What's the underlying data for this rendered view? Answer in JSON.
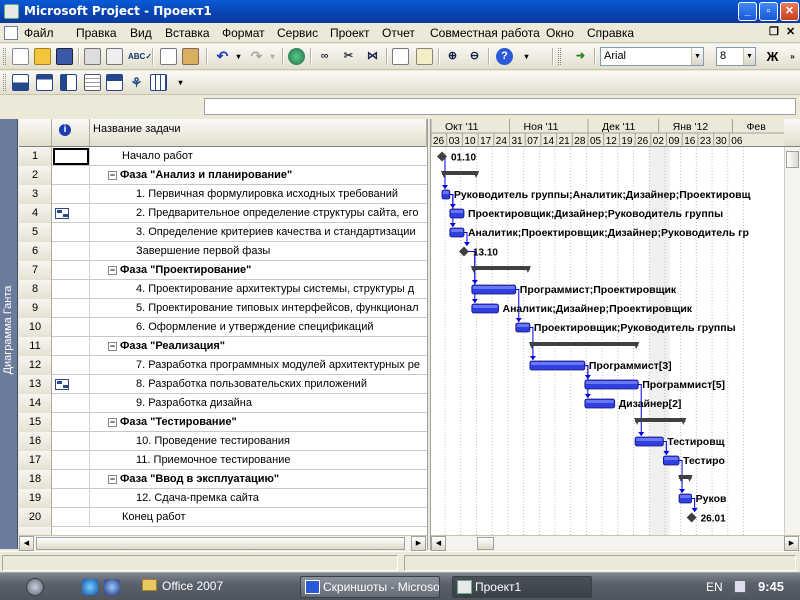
{
  "window": {
    "title": "Microsoft Project - Проект1"
  },
  "menu": [
    "Файл",
    "Правка",
    "Вид",
    "Вставка",
    "Формат",
    "Сервис",
    "Проект",
    "Отчет",
    "Совместная работа",
    "Окно",
    "Справка"
  ],
  "formatting": {
    "font": "Arial",
    "size": "8",
    "bold": "Ж"
  },
  "toolbar_icons": [
    "new-icon",
    "open-icon",
    "save-icon",
    "print-icon",
    "print-preview-icon",
    "spelling-icon",
    "copy-icon",
    "paste-icon",
    "undo-icon",
    "redo-icon",
    "hyperlink-icon",
    "link-tasks-icon",
    "unlink-tasks-icon",
    "split-task-icon",
    "task-info-icon",
    "task-notes-icon",
    "zoom-in-icon",
    "zoom-out-icon",
    "help-icon"
  ],
  "view_icons": [
    "gantt-view-icon",
    "tracking-gantt-icon",
    "task-usage-icon",
    "calendar-view-icon",
    "network-diagram-icon",
    "resource-sheet-icon",
    "resource-usage-icon"
  ],
  "sidebar": {
    "view_name": "Диаграмма Ганта"
  },
  "table": {
    "headers": {
      "info": "i",
      "name": "Название задачи"
    },
    "rows": [
      {
        "id": "1",
        "name": "Начало работ",
        "level": 0,
        "summary": false,
        "note": false
      },
      {
        "id": "2",
        "name": "Фаза \"Анализ и планирование\"",
        "level": 0,
        "summary": true,
        "note": false
      },
      {
        "id": "3",
        "name": "1. Первичная формулировка исходных требований",
        "level": 1,
        "summary": false,
        "note": false
      },
      {
        "id": "4",
        "name": "2. Предварительное определение структуры сайта, его",
        "level": 1,
        "summary": false,
        "note": true
      },
      {
        "id": "5",
        "name": "3. Определение критериев качества и стандартизации",
        "level": 1,
        "summary": false,
        "note": false
      },
      {
        "id": "6",
        "name": "Завершение первой фазы",
        "level": 1,
        "summary": false,
        "note": false
      },
      {
        "id": "7",
        "name": "Фаза \"Проектирование\"",
        "level": 0,
        "summary": true,
        "note": false
      },
      {
        "id": "8",
        "name": "4. Проектирование архитектуры системы, структуры д",
        "level": 1,
        "summary": false,
        "note": false
      },
      {
        "id": "9",
        "name": "5. Проектирование типовых интерфейсов, функционал",
        "level": 1,
        "summary": false,
        "note": false
      },
      {
        "id": "10",
        "name": "6. Оформление и утверждение спецификаций",
        "level": 1,
        "summary": false,
        "note": false
      },
      {
        "id": "11",
        "name": "Фаза \"Реализация\"",
        "level": 0,
        "summary": true,
        "note": false
      },
      {
        "id": "12",
        "name": "7. Разработка программных модулей архитектурных ре",
        "level": 1,
        "summary": false,
        "note": false
      },
      {
        "id": "13",
        "name": "8. Разработка пользовательских приложений",
        "level": 1,
        "summary": false,
        "note": true
      },
      {
        "id": "14",
        "name": "9. Разработка дизайна",
        "level": 1,
        "summary": false,
        "note": false
      },
      {
        "id": "15",
        "name": "Фаза \"Тестирование\"",
        "level": 0,
        "summary": true,
        "note": false
      },
      {
        "id": "16",
        "name": "10. Проведение тестирования",
        "level": 1,
        "summary": false,
        "note": false
      },
      {
        "id": "17",
        "name": "11. Приемочное тестирование",
        "level": 1,
        "summary": false,
        "note": false
      },
      {
        "id": "18",
        "name": "Фаза \"Ввод в эксплуатацию\"",
        "level": 0,
        "summary": true,
        "note": false
      },
      {
        "id": "19",
        "name": "12. Сдача-премка сайта",
        "level": 1,
        "summary": false,
        "note": false
      },
      {
        "id": "20",
        "name": "Конец работ",
        "level": 0,
        "summary": false,
        "note": false
      }
    ]
  },
  "gantt": {
    "months": [
      {
        "label": "Окт '11"
      },
      {
        "label": "Ноя '11"
      },
      {
        "label": "Дек '11"
      },
      {
        "label": "Янв '12"
      },
      {
        "label": "Фев"
      }
    ],
    "days": [
      "26",
      "03",
      "10",
      "17",
      "24",
      "31",
      "07",
      "14",
      "21",
      "28",
      "05",
      "12",
      "19",
      "26",
      "02",
      "09",
      "16",
      "23",
      "30",
      "06"
    ],
    "tasks": [
      {
        "row": 1,
        "type": "milestone",
        "start": 0.7,
        "label": "01.10"
      },
      {
        "row": 2,
        "type": "summary",
        "start": 0.7,
        "end": 3.0
      },
      {
        "row": 3,
        "type": "task",
        "start": 0.7,
        "end": 1.2,
        "label": "Руководитель группы;Аналитик;Дизайнер;Проектировщ"
      },
      {
        "row": 4,
        "type": "task",
        "start": 1.2,
        "end": 2.1,
        "label": "Проектировщик;Дизайнер;Руководитель группы"
      },
      {
        "row": 5,
        "type": "task",
        "start": 1.2,
        "end": 2.1,
        "label": "Аналитик;Проектировщик;Дизайнер;Руководитель гр"
      },
      {
        "row": 6,
        "type": "milestone",
        "start": 2.1,
        "label": "13.10"
      },
      {
        "row": 7,
        "type": "summary",
        "start": 2.6,
        "end": 6.3
      },
      {
        "row": 8,
        "type": "task",
        "start": 2.6,
        "end": 5.4,
        "label": "Программист;Проектировщик"
      },
      {
        "row": 9,
        "type": "task",
        "start": 2.6,
        "end": 4.3,
        "label": "Аналитик;Дизайнер;Проектировщик"
      },
      {
        "row": 10,
        "type": "task",
        "start": 5.4,
        "end": 6.3,
        "label": "Проектировщик;Руководитель группы"
      },
      {
        "row": 11,
        "type": "summary",
        "start": 6.3,
        "end": 13.2
      },
      {
        "row": 12,
        "type": "task",
        "start": 6.3,
        "end": 9.8,
        "label": "Программист[3]"
      },
      {
        "row": 13,
        "type": "task",
        "start": 9.8,
        "end": 13.2,
        "label": "Программист[5]"
      },
      {
        "row": 14,
        "type": "task",
        "start": 9.8,
        "end": 11.7,
        "label": "Дизайнер[2]"
      },
      {
        "row": 15,
        "type": "summary",
        "start": 13.0,
        "end": 16.2
      },
      {
        "row": 16,
        "type": "task",
        "start": 13.0,
        "end": 14.8,
        "label": "Тестировщ"
      },
      {
        "row": 17,
        "type": "task",
        "start": 14.8,
        "end": 15.8,
        "label": "Тестиро"
      },
      {
        "row": 18,
        "type": "summary",
        "start": 15.8,
        "end": 16.6
      },
      {
        "row": 19,
        "type": "task",
        "start": 15.8,
        "end": 16.6,
        "label": "Руков"
      },
      {
        "row": 20,
        "type": "milestone",
        "start": 16.6,
        "label": "26.01"
      }
    ],
    "links": [
      [
        1,
        3
      ],
      [
        3,
        4
      ],
      [
        3,
        5
      ],
      [
        5,
        6
      ],
      [
        6,
        8
      ],
      [
        6,
        9
      ],
      [
        8,
        10
      ],
      [
        10,
        12
      ],
      [
        12,
        13
      ],
      [
        12,
        14
      ],
      [
        13,
        16
      ],
      [
        16,
        17
      ],
      [
        17,
        19
      ],
      [
        19,
        20
      ]
    ],
    "colors": {
      "bar": "#2f3fe0",
      "summary": "#404040",
      "link": "#0000e0",
      "milestone": "#404040"
    }
  },
  "taskbar": {
    "quicklaunch_icons": [
      "ie-icon",
      "ie2-icon"
    ],
    "folder": "Office 2007",
    "buttons": [
      {
        "label": "Скриншоты - Microso...",
        "active": false
      },
      {
        "label": "Проект1",
        "active": true
      }
    ],
    "lang": "EN",
    "clock": "9:45"
  }
}
